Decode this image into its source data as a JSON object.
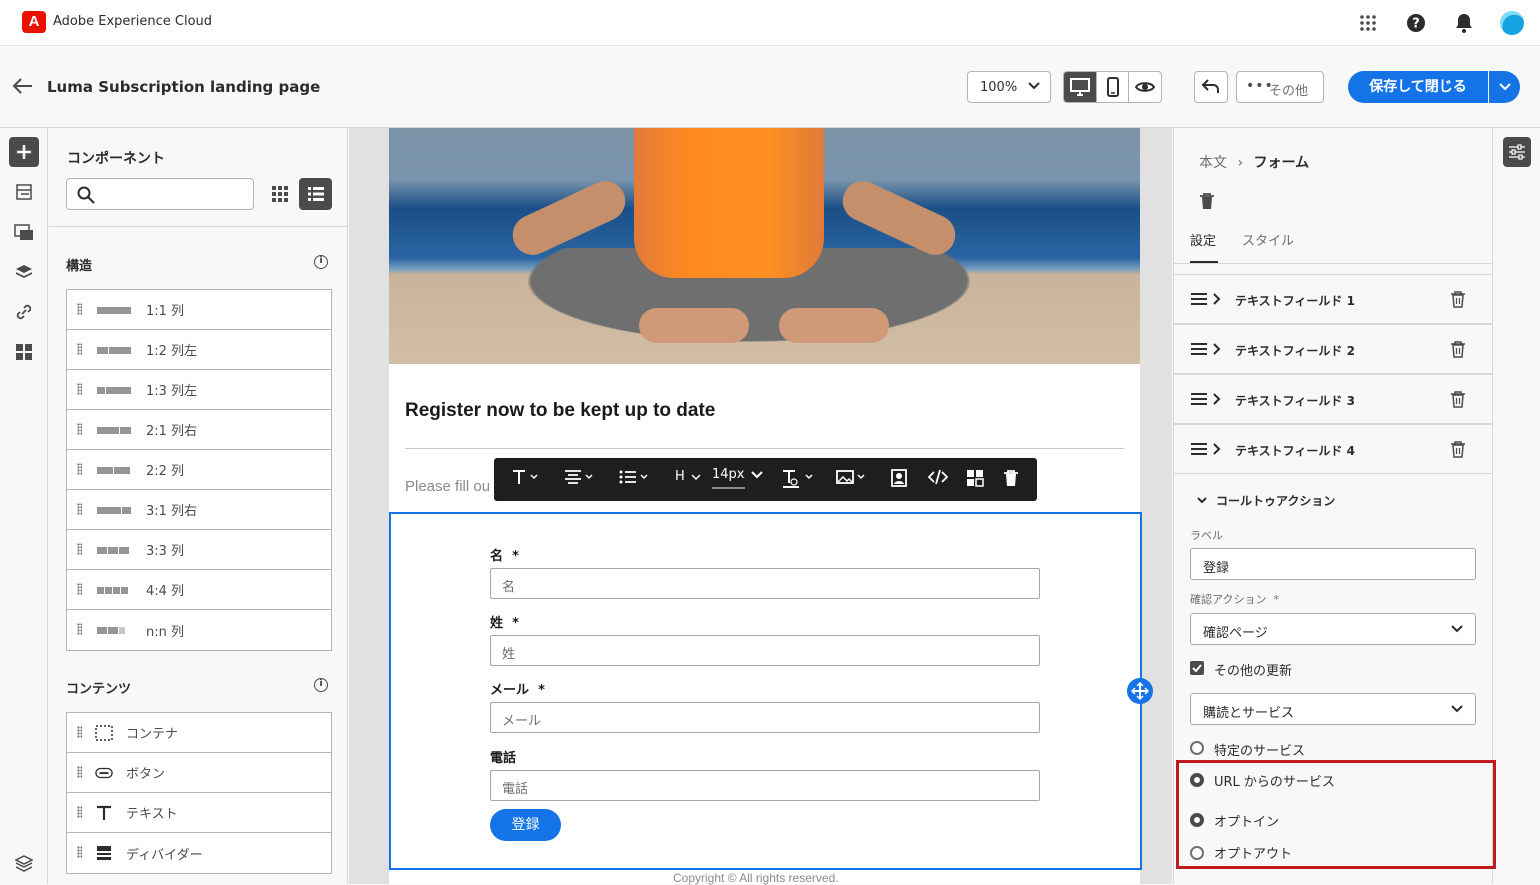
{
  "app": {
    "brand": "Adobe Experience Cloud",
    "logo_letter": "A"
  },
  "header": {
    "title": "Luma Subscription landing page",
    "zoom": "100%",
    "more_label": "その他",
    "save_label": "保存して閉じる"
  },
  "left_panel": {
    "title": "コンポーネント",
    "search_placeholder": "",
    "structure_title": "構造",
    "structure_items": [
      "1:1 列",
      "1:2 列左",
      "1:3 列左",
      "2:1 列右",
      "2:2 列",
      "3:1 列右",
      "3:3 列",
      "4:4 列",
      "n:n 列"
    ],
    "content_title": "コンテンツ",
    "content_items": [
      "コンテナ",
      "ボタン",
      "テキスト",
      "ディバイダー"
    ]
  },
  "canvas": {
    "heading": "Register now to be kept up to date",
    "fillout": "Please fill ou",
    "toolbar": {
      "heading": "H",
      "font_size": "14px"
    },
    "form": {
      "fields": [
        {
          "label": "名",
          "required": "*",
          "placeholder": "名"
        },
        {
          "label": "姓",
          "required": "*",
          "placeholder": "姓"
        },
        {
          "label": "メール",
          "required": "*",
          "placeholder": "メール"
        },
        {
          "label": "電話",
          "required": "",
          "placeholder": "電話"
        }
      ],
      "submit": "登録"
    },
    "copyright": "Copyright ©  All rights reserved."
  },
  "right_panel": {
    "breadcrumb_parent": "本文",
    "breadcrumb_current": "フォーム",
    "tabs": [
      "設定",
      "スタイル"
    ],
    "fields": [
      "テキストフィールド 1",
      "テキストフィールド 2",
      "テキストフィールド 3",
      "テキストフィールド 4"
    ],
    "cta_title": "コールトゥアクション",
    "label_label": "ラベル",
    "label_value": "登録",
    "confirm_label": "確認アクション",
    "confirm_required": "*",
    "confirm_value": "確認ページ",
    "other_updates": "その他の更新",
    "subscription_value": "購読とサービス",
    "radio_specific": "特定のサービス",
    "radio_url": "URL からのサービス",
    "radio_optin": "オプトイン",
    "radio_optout": "オプトアウト"
  },
  "colors": {
    "accent": "#1473e6",
    "highlight": "#c0191f",
    "adobe_red": "#eb1000"
  }
}
